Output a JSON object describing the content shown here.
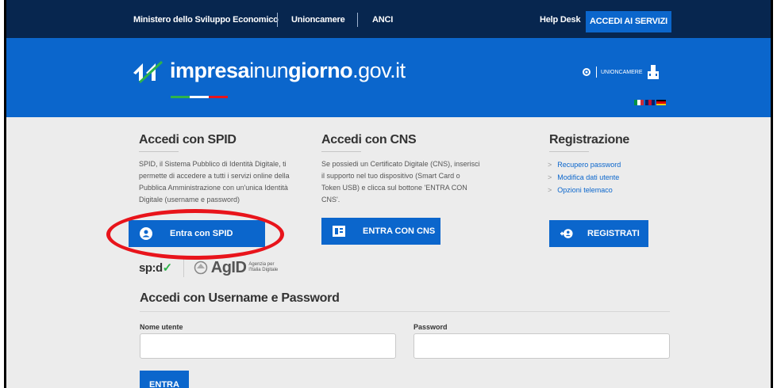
{
  "topbar": {
    "links": [
      "Ministero dello Sviluppo Economico",
      "Unioncamere",
      "ANCI"
    ],
    "helpdesk": "Help Desk",
    "accedi_servizi": "ACCEDI AI SERVIZI"
  },
  "header": {
    "logo_part1": "impresa",
    "logo_part2": "inun",
    "logo_part3": "giorno",
    "logo_part4": ".gov.it",
    "unioncamere_label": "UNIONCAMERE",
    "flag_colors": {
      "italy": [
        "#009246",
        "#ffffff",
        "#ce2b37"
      ],
      "uk": [
        "#012169",
        "#c8102e",
        "#012169"
      ],
      "germany": [
        "#000000",
        "#dd0000",
        "#ffce00"
      ]
    }
  },
  "spid": {
    "title": "Accedi con SPID",
    "line1": "SPID, il Sistema Pubblico di Identità Digitale, ti",
    "line2": "permette di accedere a tutti i servizi online della",
    "line3": "Pubblica Amministrazione con un'unica Identità",
    "line4": "Digitale (username e password)",
    "button": "Entra con SPID",
    "logo_spid": "sp:d",
    "logo_check": "✓",
    "logo_agid": "AgID",
    "logo_agid_small1": "Agenzia per",
    "logo_agid_small2": "l'Italia Digitale"
  },
  "cns": {
    "title": "Accedi con CNS",
    "line1": "Se possiedi un Certificato Digitale (CNS), inserisci",
    "line2": "il supporto nel tuo dispositivo (Smart Card o",
    "line3": "Token USB) e clicca sul bottone 'ENTRA CON",
    "line4": "CNS'.",
    "button": "ENTRA CON CNS"
  },
  "registrazione": {
    "title": "Registrazione",
    "links": [
      "Recupero password",
      "Modifica dati utente",
      "Opzioni telemaco"
    ],
    "arrow": ">",
    "button": "REGISTRATI"
  },
  "login": {
    "title": "Accedi con Username e Password",
    "username_label": "Nome utente",
    "password_label": "Password",
    "username_value": "",
    "password_value": "",
    "submit": "ENTRA"
  },
  "colors": {
    "navy": "#07264f",
    "brand_blue": "#0b66cc",
    "annotation_red": "#e8141b",
    "page_bg": "#ececec"
  }
}
